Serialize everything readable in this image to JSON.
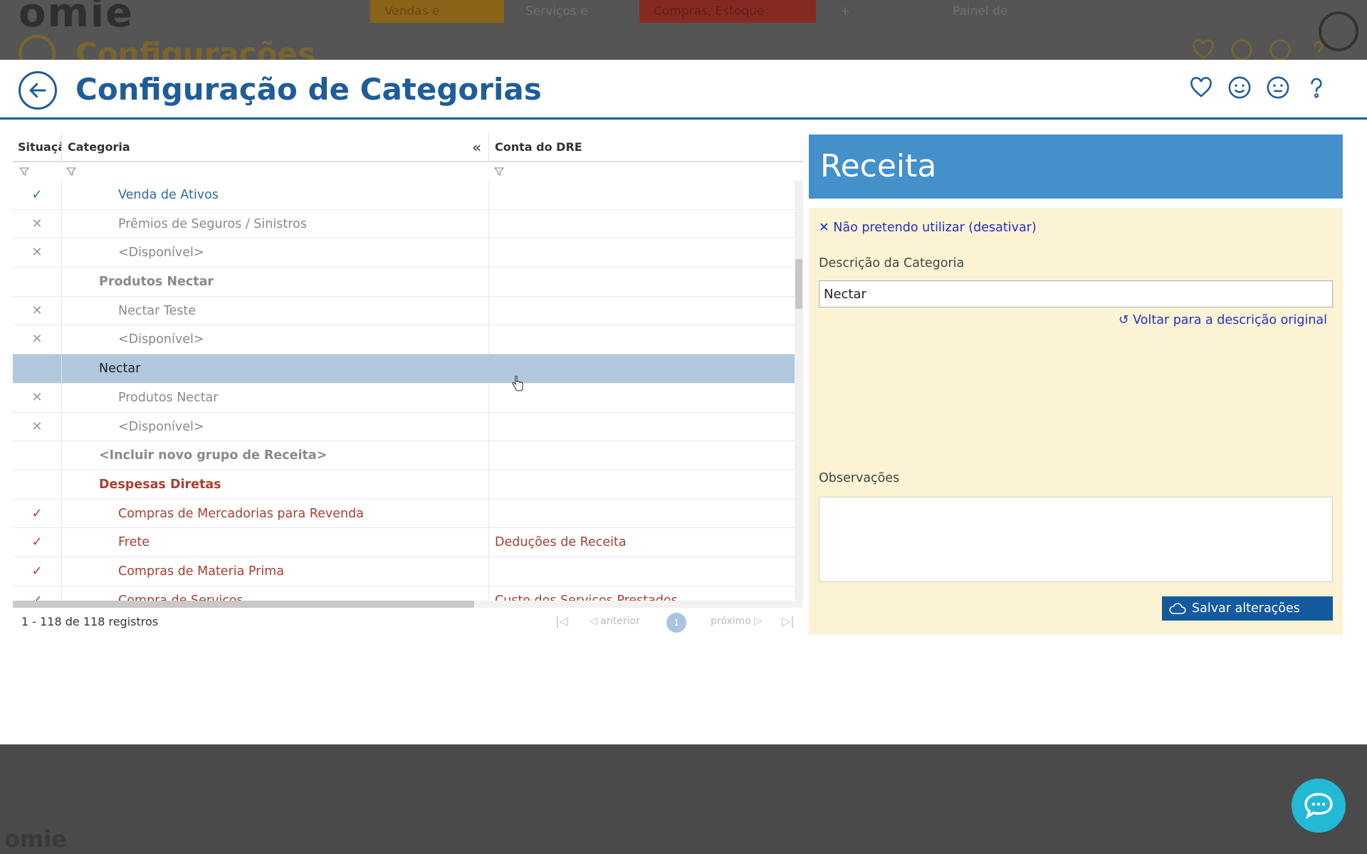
{
  "background": {
    "logo": "omie",
    "tabs": [
      "Vendas e",
      "Serviços e",
      "Compras, Estoque",
      "+",
      "Painel de"
    ],
    "title": "Configurações"
  },
  "header": {
    "title": "Configuração de Categorias",
    "icons": [
      "heart-icon",
      "smile-icon",
      "neutral-face-icon",
      "help-icon"
    ]
  },
  "grid": {
    "columns": {
      "situacao": "Situação",
      "categoria": "Categoria",
      "conta_dre": "Conta do DRE"
    },
    "collapse_symbol": "«",
    "rows": [
      {
        "status": "✓",
        "category": "Venda de Ativos",
        "dre": ""
      },
      {
        "status": "✕",
        "category": "Prêmios de Seguros / Sinistros",
        "dre": ""
      },
      {
        "status": "✕",
        "category": "<Disponível>",
        "dre": ""
      },
      {
        "status": "",
        "category": "Produtos Nectar",
        "dre": ""
      },
      {
        "status": "✕",
        "category": "Nectar Teste",
        "dre": ""
      },
      {
        "status": "✕",
        "category": "<Disponível>",
        "dre": ""
      },
      {
        "status": "",
        "category": "Nectar",
        "dre": ""
      },
      {
        "status": "✕",
        "category": "Produtos Nectar",
        "dre": ""
      },
      {
        "status": "✕",
        "category": "<Disponível>",
        "dre": ""
      },
      {
        "status": "",
        "category": "<Incluir novo grupo de Receita>",
        "dre": ""
      },
      {
        "status": "",
        "category": "Despesas Diretas",
        "dre": ""
      },
      {
        "status": "✓",
        "category": "Compras de Mercadorias para Revenda",
        "dre": ""
      },
      {
        "status": "✓",
        "category": "Frete",
        "dre": "Deduções de Receita"
      },
      {
        "status": "✓",
        "category": "Compras de Materia Prima",
        "dre": ""
      },
      {
        "status": "✓",
        "category": "Compra de Serviços",
        "dre": "Custo dos Serviços Prestados"
      }
    ],
    "pager": {
      "count": "1 - 118 de 118 registros",
      "prev": "anterior",
      "page": "1",
      "next": "próximo"
    }
  },
  "panel": {
    "title": "Receita",
    "deactivate": "Não pretendo utilizar (desativar)",
    "description_label": "Descrição da Categoria",
    "description_value": "Nectar",
    "restore": "Voltar para a descrição original",
    "notes_label": "Observações",
    "notes_value": "",
    "save": "Salvar alterações"
  },
  "footer": {
    "logo": "omie"
  },
  "colors": {
    "primary": "#1f5c99",
    "panel_header": "#4390cb",
    "panel_bg": "#fbf3d3",
    "selected_row": "#b0c7dd",
    "link": "#2330c8",
    "expense": "#a8402f",
    "chat": "#22b9d5"
  }
}
